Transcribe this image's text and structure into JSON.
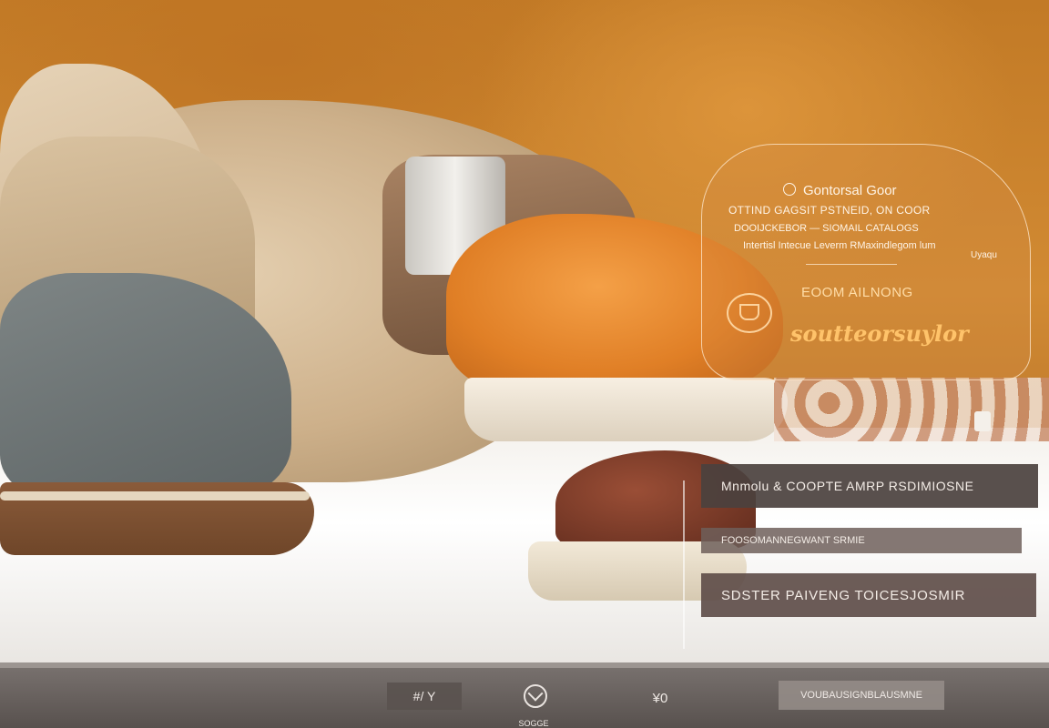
{
  "info_panel": {
    "heading": "Gontorsal Goor",
    "line1": "OTTIND GAGSIT PSTNEID, ON COOR",
    "line2": "DOOIJCKEBOR  —  SIOMAIL CATALOGS",
    "line3": "Intertisl Intecue Leverm  RMaxindlegom lum",
    "line4": "Uyaqu",
    "subheading": "EOOM AILNONG",
    "script_text": "soutteorsuylor"
  },
  "cards": {
    "card1": "Mnmolu & COOPTE AMRP RSDIMIOSNE",
    "card2": "FOOSOMANNEGWANT SRMIE",
    "card3": "SDSTER PAIVENG TOICESJOSMIR"
  },
  "bottom_bar": {
    "btn_left": "#/ Y",
    "btn_right": "¥0",
    "btn_wide": "VOUBAUSIGNBLAUSMNE",
    "caption": "SOGGE"
  }
}
